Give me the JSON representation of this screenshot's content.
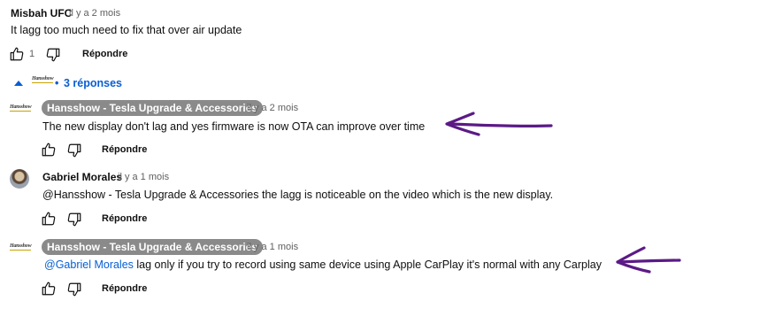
{
  "comment_top": {
    "author": "Misbah UFC",
    "time": "il y a 2 mois",
    "text": "It lagg too much need to fix that over air update",
    "likes": "1",
    "reply_label": "Répondre"
  },
  "replies_toggle": {
    "dot": "•",
    "label": "3 réponses",
    "logo_text": "Hansshow"
  },
  "replies": [
    {
      "author": "Hansshow - Tesla Upgrade & Accessories",
      "time": "il y a 2 mois",
      "text": "The new display don't lag and yes firmware is now OTA can improve over time",
      "reply_label": "Répondre",
      "logo_text": "Hansshow"
    },
    {
      "author": "Gabriel Morales",
      "time": "il y a 1 mois",
      "text": "@Hansshow - Tesla Upgrade & Accessories  the lagg is noticeable on the video which is the new display.",
      "reply_label": "Répondre"
    },
    {
      "author": "Hansshow - Tesla Upgrade & Accessories",
      "time": "il y a 1 mois",
      "mention": "@Gabriel Morales",
      "text": " lag only if you try to record using same device using Apple CarPlay it's normal with any Carplay",
      "reply_label": "Répondre",
      "logo_text": "Hansshow"
    }
  ],
  "annotation_color": "#5b1a86",
  "icons": [
    "thumbs-up-icon",
    "thumbs-down-icon",
    "chevron-up-icon",
    "arrow-annotation"
  ]
}
